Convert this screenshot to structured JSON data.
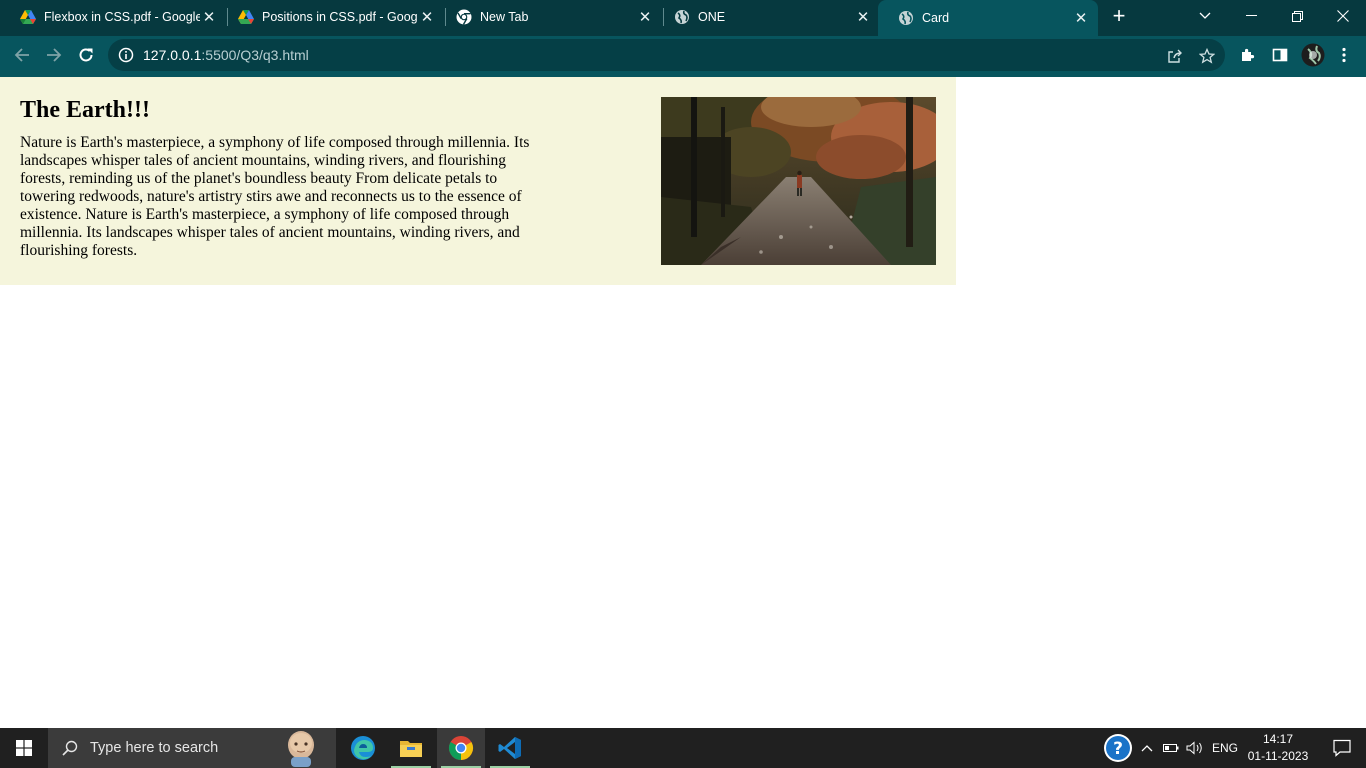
{
  "browser": {
    "tabs": [
      {
        "title": "Flexbox in CSS.pdf - Google",
        "icon": "google-drive-icon",
        "active": false
      },
      {
        "title": "Positions in CSS.pdf - Google",
        "icon": "google-drive-icon",
        "active": false
      },
      {
        "title": "New Tab",
        "icon": "chrome-icon",
        "active": false
      },
      {
        "title": "ONE",
        "icon": "globe-icon",
        "active": false
      },
      {
        "title": "Card",
        "icon": "globe-icon",
        "active": true
      }
    ],
    "url_host": "127.0.0.1",
    "url_path": ":5500/Q3/q3.html"
  },
  "page": {
    "heading": "The Earth!!!",
    "paragraph": "Nature is Earth's masterpiece, a symphony of life composed through millennia. Its landscapes whisper tales of ancient mountains, winding rivers, and flourishing forests, reminding us of the planet's boundless beauty From delicate petals to towering redwoods, nature's artistry stirs awe and reconnects us to the essence of existence. Nature is Earth's masterpiece, a symphony of life composed through millennia. Its landscapes whisper tales of ancient mountains, winding rivers, and flourishing forests.",
    "card_bg": "#f5f5dc"
  },
  "taskbar": {
    "search_placeholder": "Type here to search",
    "language": "ENG",
    "time": "14:17",
    "date": "01-11-2023"
  },
  "colors": {
    "tabstrip": "#06393f",
    "toolbar": "#07555e"
  }
}
